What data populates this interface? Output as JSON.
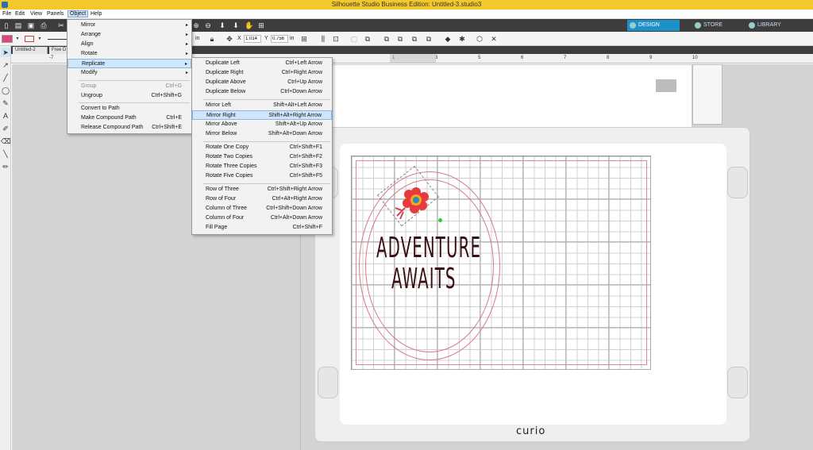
{
  "window": {
    "title": "Silhouette Studio Business Edition: Untitled-3.studio3"
  },
  "menubar": [
    "File",
    "Edit",
    "View",
    "Panels",
    "Object",
    "Help"
  ],
  "nav_tabs": [
    {
      "label": "DESIGN"
    },
    {
      "label": "STORE"
    },
    {
      "label": "LIBRARY"
    }
  ],
  "toolbar2": {
    "unit_in": "in",
    "x_label": "X",
    "x_value": "1.014",
    "y_label": "Y",
    "y_value": "0.756",
    "unit_in2": "in"
  },
  "doc_tabs": [
    "Untitled-2",
    "Free D"
  ],
  "ruler_labels": [
    "-7",
    "1",
    "3",
    "5",
    "6",
    "7",
    "8",
    "9",
    "10"
  ],
  "object_menu": [
    {
      "label": "Mirror",
      "arrow": "▸"
    },
    {
      "label": "Arrange",
      "arrow": "▸"
    },
    {
      "label": "Align",
      "arrow": "▸"
    },
    {
      "label": "Rotate",
      "arrow": "▸"
    },
    {
      "label": "Replicate",
      "arrow": "▸"
    },
    {
      "label": "Modify",
      "arrow": "▸"
    },
    {
      "label": "Group",
      "shortcut": "Ctrl+G"
    },
    {
      "label": "Ungroup",
      "shortcut": "Ctrl+Shift+G"
    },
    {
      "label": "Convert to Path",
      "shortcut": ""
    },
    {
      "label": "Make Compound Path",
      "shortcut": "Ctrl+E"
    },
    {
      "label": "Release Compound Path",
      "shortcut": "Ctrl+Shift+E"
    }
  ],
  "replicate_menu": [
    {
      "label": "Duplicate Left",
      "shortcut": "Ctrl+Left Arrow"
    },
    {
      "label": "Duplicate Right",
      "shortcut": "Ctrl+Right Arrow"
    },
    {
      "label": "Duplicate Above",
      "shortcut": "Ctrl+Up Arrow"
    },
    {
      "label": "Duplicate Below",
      "shortcut": "Ctrl+Down Arrow"
    },
    {
      "label": "Mirror Left",
      "shortcut": "Shift+Alt+Left Arrow"
    },
    {
      "label": "Mirror Right",
      "shortcut": "Shift+Alt+Right Arrow"
    },
    {
      "label": "Mirror Above",
      "shortcut": "Shift+Alt+Up Arrow"
    },
    {
      "label": "Mirror Below",
      "shortcut": "Shift+Alt+Down Arrow"
    },
    {
      "label": "Rotate One Copy",
      "shortcut": "Ctrl+Shift+F1"
    },
    {
      "label": "Rotate Two Copies",
      "shortcut": "Ctrl+Shift+F2"
    },
    {
      "label": "Rotate Three Copies",
      "shortcut": "Ctrl+Shift+F3"
    },
    {
      "label": "Rotate Five Copies",
      "shortcut": "Ctrl+Shift+F5"
    },
    {
      "label": "Row of Three",
      "shortcut": "Ctrl+Shift+Right Arrow"
    },
    {
      "label": "Row of Four",
      "shortcut": "Ctrl+Alt+Right Arrow"
    },
    {
      "label": "Column of Three",
      "shortcut": "Ctrl+Shift+Down Arrow"
    },
    {
      "label": "Column of Four",
      "shortcut": "Ctrl+Alt+Down Arrow"
    },
    {
      "label": "Fill Page",
      "shortcut": "Ctrl+Shift+F"
    }
  ],
  "design": {
    "line1": "ADVENTURE",
    "line2": "AWAITS"
  },
  "mat_brand": "curio",
  "colors": {
    "titlebar": "#f4c82a",
    "toolbar": "#3d3d3d",
    "accent": "#1e90c8",
    "fill_swatch": "#e0457b",
    "text": "#3a0f14"
  }
}
